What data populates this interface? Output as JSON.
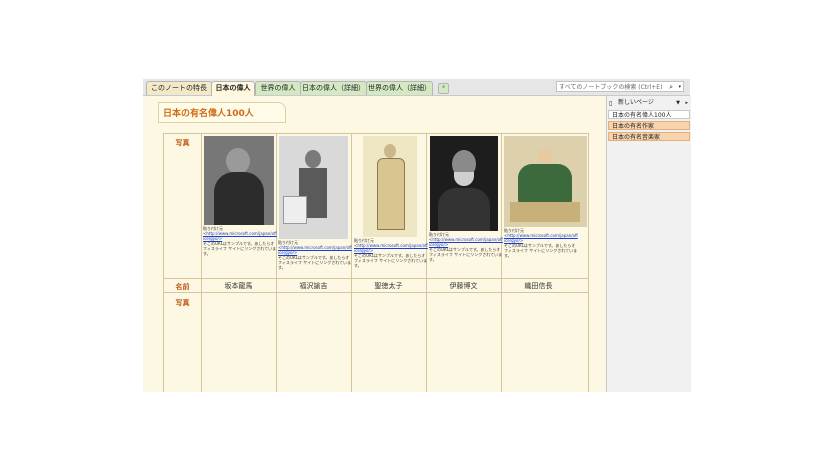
{
  "tabs": [
    {
      "label": "このノートの特長"
    },
    {
      "label": "日本の偉人"
    },
    {
      "label": "世界の偉人"
    },
    {
      "label": "日本の偉人（詳細）"
    },
    {
      "label": "世界の偉人（詳細）"
    }
  ],
  "search": {
    "placeholder": "すべてのノートブックの検索 (Ctrl+E)"
  },
  "page": {
    "title": "日本の有名偉人100人"
  },
  "table": {
    "row_labels": {
      "photo": "写真",
      "name": "名前",
      "photo2": "写真"
    },
    "people": [
      {
        "name": "坂本龍馬",
        "cap_head": "貼り付け元",
        "cap_url": "<http://www.microsoft.com/japan/office/gyo/>",
        "cap_text": "そこのURLはサンプルです。あしたらオフィスライフ サイトにリンクされています。",
        "colors": [
          "#262626",
          "#6e6e6e"
        ]
      },
      {
        "name": "福沢諭吉",
        "cap_head": "貼り付け元",
        "cap_url": "<http://www.microsoft.com/japan/office/gyo/>",
        "cap_text": "そこのURLはサンプルです。あしたらオフィスライフ サイトにリンクされています。",
        "colors": [
          "#d9d9d9",
          "#6b6b6b"
        ]
      },
      {
        "name": "聖徳太子",
        "cap_head": "貼り付け元",
        "cap_url": "<http://www.microsoft.com/japan/office/gyo/>",
        "cap_text": "そこのURLはサンプルです。あしたらオフィスライフ サイトにリンクされています。",
        "colors": [
          "#efe6c4",
          "#8c7a52"
        ]
      },
      {
        "name": "伊藤博文",
        "cap_head": "貼り付け元",
        "cap_url": "<http://www.microsoft.com/japan/office/gyo/>",
        "cap_text": "そこのURLはサンプルです。あしたらオフィスライフ サイトにリンクされています。",
        "colors": [
          "#1d1d1d",
          "#8a8a8a"
        ]
      },
      {
        "name": "織田信長",
        "cap_head": "貼り付け元",
        "cap_url": "<http://www.microsoft.com/japan/office/gyo/>",
        "cap_text": "そこのURLはサンプルです。あしたらオフィスライフ サイトにリンクされています。",
        "colors": [
          "#ddd0ad",
          "#3c6a3c"
        ]
      }
    ]
  },
  "sidebar": {
    "new_page": "新しいページ",
    "pages": [
      {
        "label": "日本の有名偉人100人"
      },
      {
        "label": "日本の有名作家"
      },
      {
        "label": "日本の有名音楽家"
      }
    ]
  },
  "colors": {
    "accent": "#d06b12",
    "tab_green": "#d4e9c2",
    "page_bg": "#fdf8e4",
    "page_tab_orange": "#f8d4ad"
  }
}
